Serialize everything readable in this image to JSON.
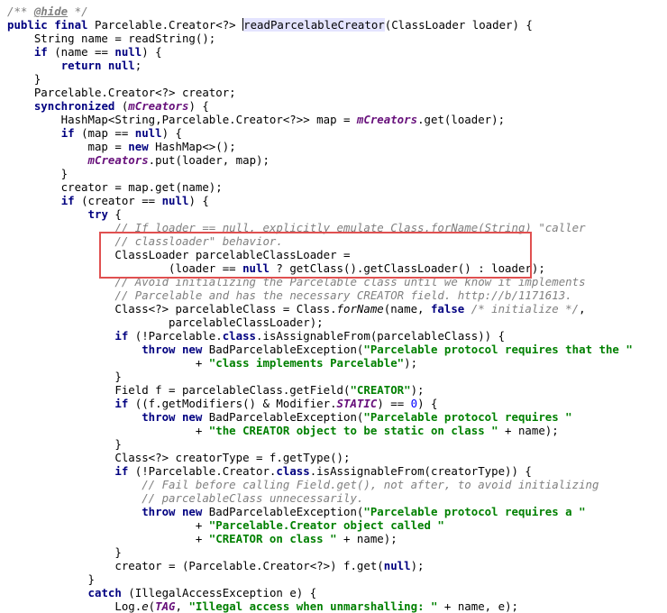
{
  "code": {
    "l1": {
      "a": "/** ",
      "b": "@hide",
      "c": " */"
    },
    "l2": {
      "a": "public final ",
      "b": "Parcelable.Creator<?> ",
      "c": "readParcelableCreator",
      "d": "(ClassLoader loader) {"
    },
    "l3": {
      "a": "    String name = readString();"
    },
    "l4": {
      "a": "    ",
      "b": "if",
      "c": " (name == ",
      "d": "null",
      "e": ") {"
    },
    "l5": {
      "a": "        ",
      "b": "return null",
      "c": ";"
    },
    "l6": {
      "a": "    }"
    },
    "l7": {
      "a": "    Parcelable.Creator<?> creator;"
    },
    "l8": {
      "a": "    ",
      "b": "synchronized",
      "c": " (",
      "d": "mCreators",
      "e": ") {"
    },
    "l9": {
      "a": "        HashMap<String,Parcelable.Creator<?>> map = ",
      "b": "mCreators",
      "c": ".get(loader);"
    },
    "l10": {
      "a": "        ",
      "b": "if",
      "c": " (map == ",
      "d": "null",
      "e": ") {"
    },
    "l11": {
      "a": "            map = ",
      "b": "new",
      "c": " HashMap<>();"
    },
    "l12": {
      "a": "            ",
      "b": "mCreators",
      "c": ".put(loader, map);"
    },
    "l13": {
      "a": "        }"
    },
    "l14": {
      "a": "        creator = map.get(name);"
    },
    "l15": {
      "a": "        ",
      "b": "if",
      "c": " (creator == ",
      "d": "null",
      "e": ") {"
    },
    "l16": {
      "a": "            ",
      "b": "try",
      "c": " {"
    },
    "l17": {
      "a": "                ",
      "b": "// If loader == null, explicitly emulate Class.forName(String) \"caller"
    },
    "l18": {
      "a": "                ",
      "b": "// classloader\" behavior."
    },
    "l19": {
      "a": "                ClassLoader parcelableClassLoader ="
    },
    "l20": {
      "a": "                        (loader == ",
      "b": "null",
      "c": " ? getClass().getClassLoader() : loader);"
    },
    "l21": {
      "a": "                ",
      "b": "// Avoid initializing the Parcelable class until we know it implements"
    },
    "l22": {
      "a": "                ",
      "b": "// Parcelable and has the necessary CREATOR field. http://b/1171613."
    },
    "l23": {
      "a": "                Class<?> parcelableClass = Class.",
      "b": "forName",
      "c": "(name, ",
      "d": "false",
      "e": " ",
      "f": "/* initialize */",
      "g": ","
    },
    "l24": {
      "a": "                        parcelableClassLoader);"
    },
    "l25": {
      "a": "                ",
      "b": "if",
      "c": " (!Parcelable.",
      "d": "class",
      "e": ".isAssignableFrom(parcelableClass)) {"
    },
    "l26": {
      "a": "                    ",
      "b": "throw new",
      "c": " BadParcelableException(",
      "d": "\"Parcelable protocol requires that the \""
    },
    "l27": {
      "a": "                            + ",
      "b": "\"class implements Parcelable\"",
      "c": ");"
    },
    "l28": {
      "a": "                }"
    },
    "l29": {
      "a": "                Field f = parcelableClass.getField(",
      "b": "\"CREATOR\"",
      "c": ");"
    },
    "l30": {
      "a": "                ",
      "b": "if",
      "c": " ((f.getModifiers() & Modifier.",
      "d": "STATIC",
      "e": ") == ",
      "f": "0",
      "g": ") {"
    },
    "l31": {
      "a": "                    ",
      "b": "throw new",
      "c": " BadParcelableException(",
      "d": "\"Parcelable protocol requires \""
    },
    "l32": {
      "a": "                            + ",
      "b": "\"the CREATOR object to be static on class \"",
      "c": " + name);"
    },
    "l33": {
      "a": "                }"
    },
    "l34": {
      "a": "                Class<?> creatorType = f.getType();"
    },
    "l35": {
      "a": "                ",
      "b": "if",
      "c": " (!Parcelable.Creator.",
      "d": "class",
      "e": ".isAssignableFrom(creatorType)) {"
    },
    "l36": {
      "a": "                    ",
      "b": "// Fail before calling Field.get(), not after, to avoid initializing"
    },
    "l37": {
      "a": "                    ",
      "b": "// parcelableClass unnecessarily."
    },
    "l38": {
      "a": "                    ",
      "b": "throw new",
      "c": " BadParcelableException(",
      "d": "\"Parcelable protocol requires a \""
    },
    "l39": {
      "a": "                            + ",
      "b": "\"Parcelable.Creator object called \""
    },
    "l40": {
      "a": "                            + ",
      "b": "\"CREATOR on class \"",
      "c": " + name);"
    },
    "l41": {
      "a": "                }"
    },
    "l42": {
      "a": "                creator = (Parcelable.Creator<?>) f.get(",
      "b": "null",
      "c": ");"
    },
    "l43": {
      "a": "            }"
    },
    "l44": {
      "a": "            ",
      "b": "catch",
      "c": " (IllegalAccessException e) {"
    },
    "l45": {
      "a": "                Log.",
      "b": "e",
      "c": "(",
      "d": "TAG",
      "e": ", ",
      "f": "\"Illegal access when unmarshalling: \"",
      "g": " + name, e);"
    }
  },
  "colors": {
    "keyword": "#000080",
    "string": "#008000",
    "comment": "#808080",
    "field": "#660E7A",
    "number": "#0000FF",
    "highlight_box": "#e05050",
    "identifier_highlight": "#e4e4ff"
  }
}
